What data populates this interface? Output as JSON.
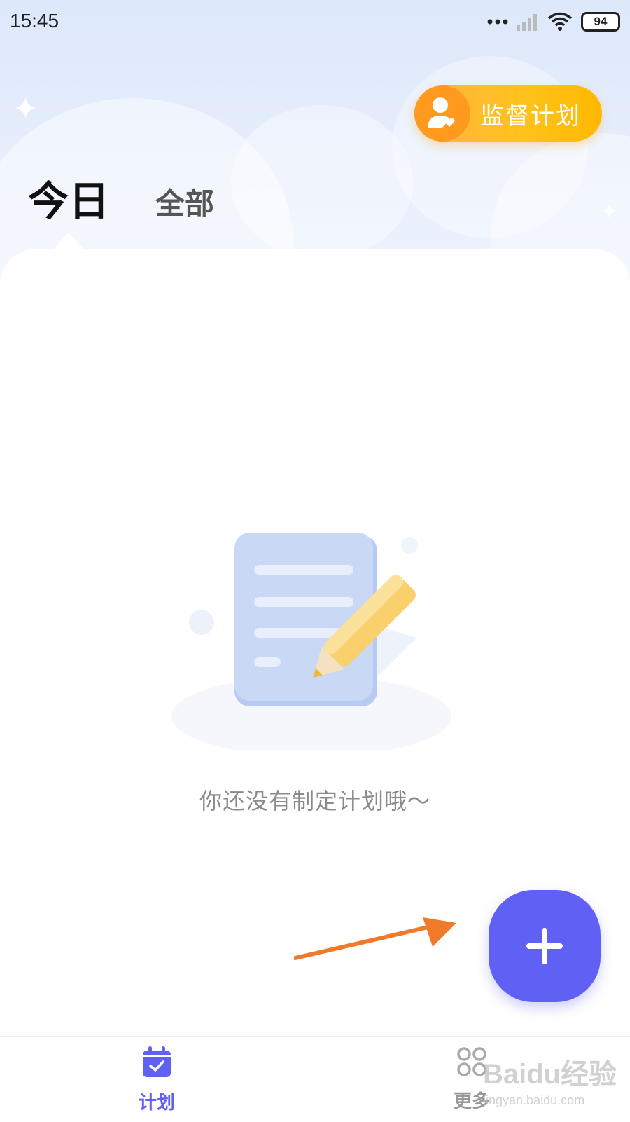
{
  "status_bar": {
    "time": "15:45",
    "battery": "94",
    "icons": [
      "more-dots-icon",
      "signal-icon",
      "wifi-icon",
      "battery-icon"
    ]
  },
  "header": {
    "supervise_button": {
      "label": "监督计划",
      "icon": "supervisor-heart-icon"
    },
    "tabs": [
      {
        "label": "今日",
        "active": true
      },
      {
        "label": "全部",
        "active": false
      }
    ]
  },
  "main": {
    "empty_state": {
      "illustration": "document-pencil-illustration",
      "message": "你还没有制定计划哦～"
    },
    "fab": {
      "icon": "plus-icon"
    },
    "annotation_arrow": {
      "color": "#f07a2a"
    }
  },
  "bottom_nav": {
    "items": [
      {
        "label": "计划",
        "icon": "calendar-check-icon",
        "active": true
      },
      {
        "label": "更多",
        "icon": "grid-more-icon",
        "active": false
      }
    ]
  },
  "watermark": {
    "brand": "Baidu经验",
    "url": "jingyan.baidu.com"
  },
  "colors": {
    "accent": "#6060f5",
    "supervise_button": "#ffc21a",
    "header_bg": "#dde8fb"
  }
}
